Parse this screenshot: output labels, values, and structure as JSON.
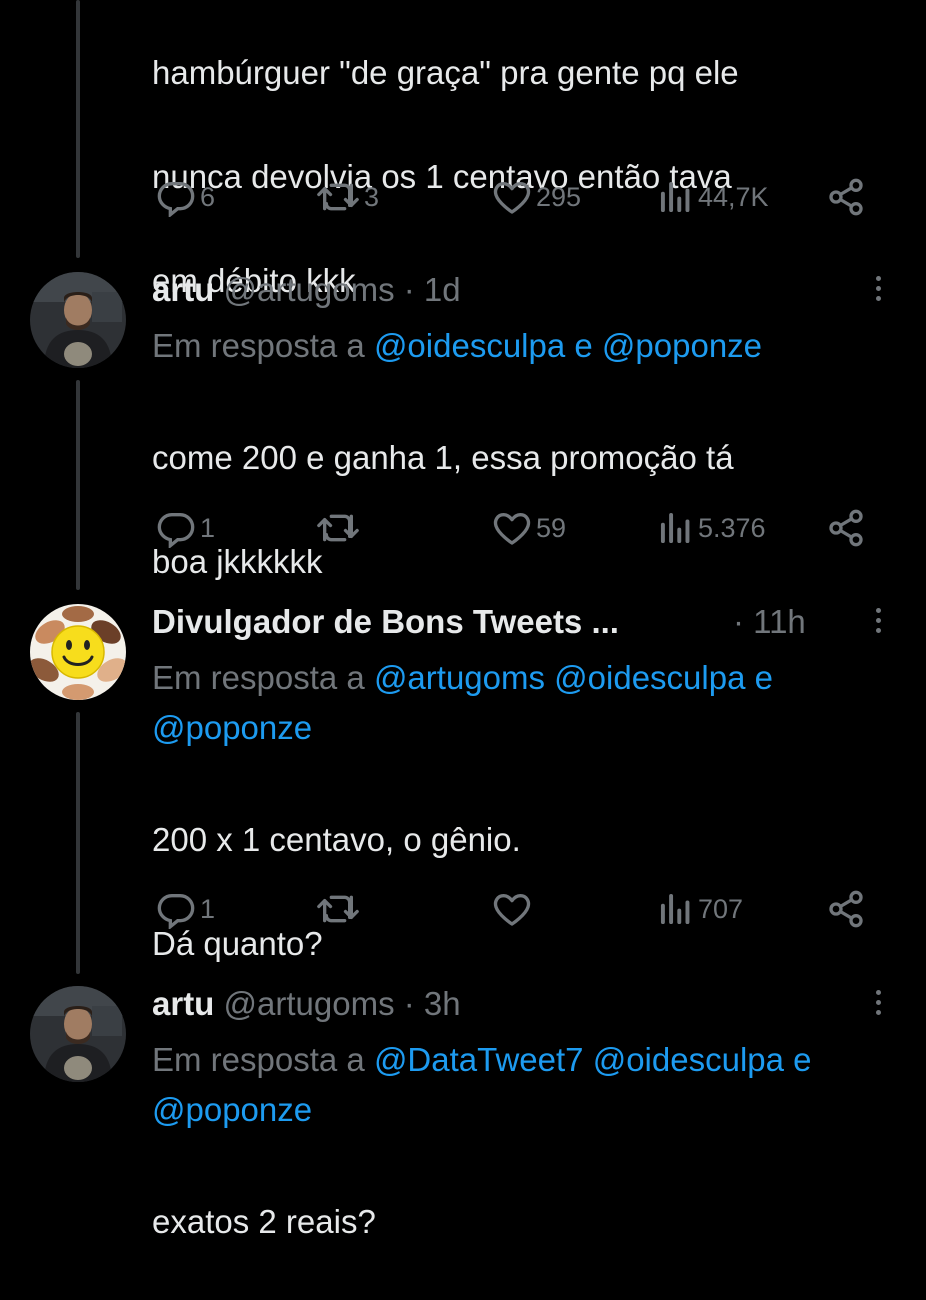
{
  "tweet_top": {
    "lines": [
      "hambúrguer \"de graça\" pra gente pq ele",
      "nunca devolvia os 1 centavo então tava",
      "em débito kkk"
    ],
    "actions": {
      "replies": "6",
      "retweets": "3",
      "likes": "295",
      "views": "44,7K"
    }
  },
  "reply1": {
    "name": "artu",
    "handle": "@artugoms",
    "time": "1d",
    "reply_prefix": "Em resposta a",
    "mentions_line1": "@oidesculpa e @poponze",
    "lines": [
      "come 200 e ganha 1, essa promoção tá",
      "boa jkkkkkk"
    ],
    "actions": {
      "replies": "1",
      "retweets": "",
      "likes": "59",
      "views": "5.376"
    }
  },
  "reply2": {
    "name": "Divulgador de Bons Tweets ...",
    "time": "11h",
    "reply_prefix": "Em resposta a",
    "mentions_line1": "@artugoms @oidesculpa e",
    "mentions_line2": "@poponze",
    "lines": [
      "200 x 1 centavo, o gênio.",
      "Dá quanto?"
    ],
    "actions": {
      "replies": "1",
      "retweets": "",
      "likes": "",
      "views": "707"
    }
  },
  "reply3": {
    "name": "artu",
    "handle": "@artugoms",
    "time": "3h",
    "reply_prefix": "Em resposta a",
    "mentions_line1": "@DataTweet7 @oidesculpa e",
    "mentions_line2": "@poponze",
    "lines": [
      "exatos 2 reais?"
    ]
  },
  "separator": "·",
  "icons": [
    "reply-icon",
    "retweet-icon",
    "like-icon",
    "views-icon",
    "share-icon",
    "more-icon"
  ],
  "colors": {
    "background": "#000000",
    "text": "#e7e9ea",
    "muted": "#71767b",
    "link": "#1d9bf0"
  }
}
